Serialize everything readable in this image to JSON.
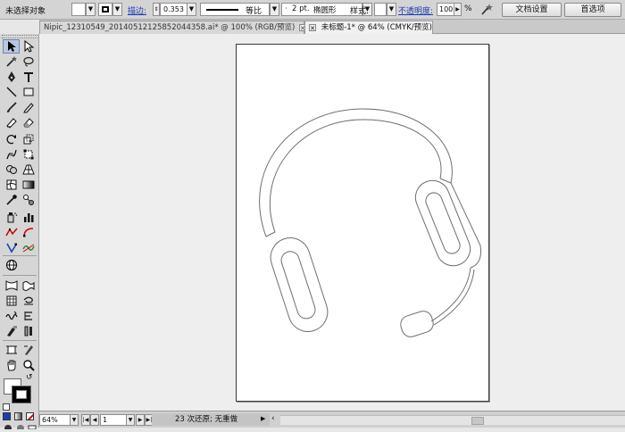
{
  "control_bar": {
    "selection_label": "未选择对象",
    "stroke_label": "描边:",
    "stroke_weight": "0.353",
    "stroke_profile": "等比",
    "brush_size": "2 pt.",
    "brush_shape": "椭圆形",
    "style_label": "样式:",
    "opacity_label": "不透明度:",
    "opacity_value": "100",
    "opacity_unit": "%",
    "doc_setup_button": "文档设置",
    "preferences_button": "首选项"
  },
  "tabs": [
    {
      "label": "Nipic_12310549_20140512125852044358.ai* @ 100% (RGB/预览)",
      "active": false
    },
    {
      "label": "未标题-1* @ 64% (CMYK/预览)",
      "active": true
    }
  ],
  "status_bar": {
    "zoom": "64%",
    "artboard_number": "1",
    "status_text": "23 次还原; 无重做"
  },
  "colors": {
    "canvas_bg": "#eeeeee",
    "artboard": "#ffffff",
    "toolbar": "#d6d6d6",
    "link": "#1b3cb5"
  }
}
